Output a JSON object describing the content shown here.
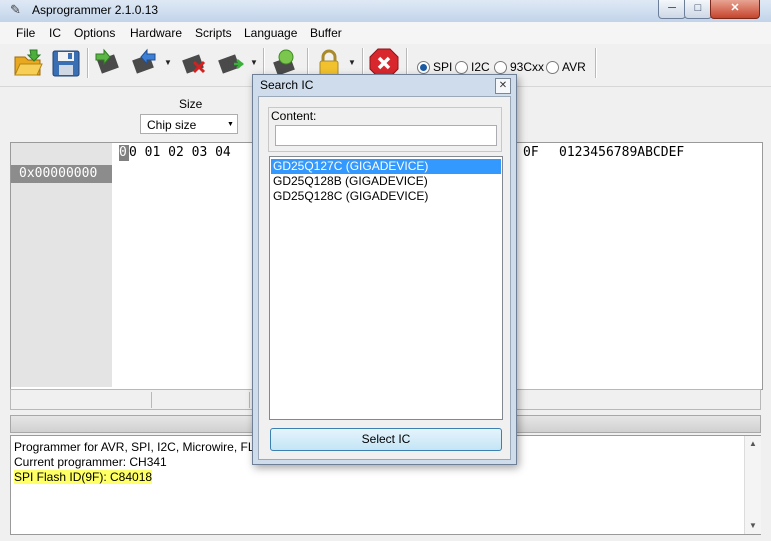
{
  "window": {
    "title": "Asprogrammer 2.1.0.13",
    "min_glyph": "─",
    "max_glyph": "□",
    "close_glyph": "✕"
  },
  "menu": [
    "File",
    "IC",
    "Options",
    "Hardware",
    "Scripts",
    "Language",
    "Buffer"
  ],
  "toolbar": {
    "icons": [
      "open-folder-icon",
      "save-icon",
      "read-chip-icon",
      "write-chip-icon",
      "erase-chip-icon",
      "verify-chip-icon",
      "read-id-icon",
      "lock-icon",
      "stop-icon"
    ],
    "protocols": [
      {
        "label": "SPI",
        "selected": true
      },
      {
        "label": "I2C",
        "selected": false
      },
      {
        "label": "93Cxx",
        "selected": false
      },
      {
        "label": "AVR",
        "selected": false
      }
    ]
  },
  "options": {
    "size_label": "Size",
    "chip_size_value": "Chip size"
  },
  "hex": {
    "col_start": "0",
    "columns": "0 01 02 03 04",
    "col_end": "0F",
    "ascii_header": "0123456789ABCDEF",
    "first_address": "0x00000000"
  },
  "log": {
    "lines": [
      "Programmer for AVR, SPI, I2C, Microwire, FLA",
      "Current programmer: CH341",
      "SPI Flash ID(9F): C84018"
    ],
    "highlight_color": "#ffff66"
  },
  "dialog": {
    "title": "Search IC",
    "close_glyph": "✕",
    "content_label": "Content:",
    "content_value": "",
    "items": [
      {
        "label": "GD25Q127C (GIGADEVICE)",
        "selected": true
      },
      {
        "label": "GD25Q128B (GIGADEVICE)",
        "selected": false
      },
      {
        "label": "GD25Q128C (GIGADEVICE)",
        "selected": false
      }
    ],
    "select_button": "Select IC"
  }
}
